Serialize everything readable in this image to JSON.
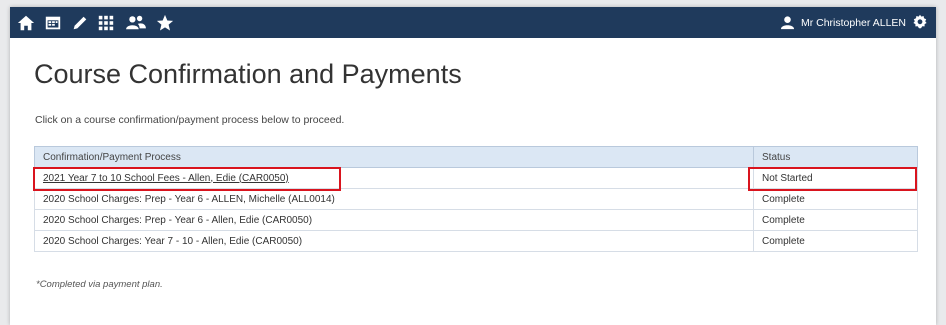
{
  "topbar": {
    "icons": [
      "home-icon",
      "calendar-icon",
      "pencil-icon",
      "grid-icon",
      "people-icon",
      "star-icon"
    ],
    "user_name": "Mr Christopher ALLEN",
    "settings_icon": "gear-icon",
    "background": "#1f3a5c"
  },
  "page": {
    "title": "Course Confirmation and Payments",
    "instructions": "Click on a course confirmation/payment process below to proceed."
  },
  "table": {
    "headers": [
      "Confirmation/Payment Process",
      "Status"
    ],
    "rows": [
      {
        "process": "2021 Year 7 to 10 School Fees - Allen, Edie (CAR0050)",
        "status": "Not Started"
      },
      {
        "process": "2020 School Charges: Prep - Year 6 - ALLEN, Michelle (ALL0014)",
        "status": "Complete"
      },
      {
        "process": "2020 School Charges: Prep - Year 6 - Allen, Edie (CAR0050)",
        "status": "Complete"
      },
      {
        "process": "2020 School Charges: Year 7 - 10 - Allen, Edie (CAR0050)",
        "status": "Complete"
      }
    ]
  },
  "footnote": "*Completed via payment plan.",
  "colors": {
    "header_bg": "#dbe7f4",
    "highlight": "#d9141e"
  }
}
